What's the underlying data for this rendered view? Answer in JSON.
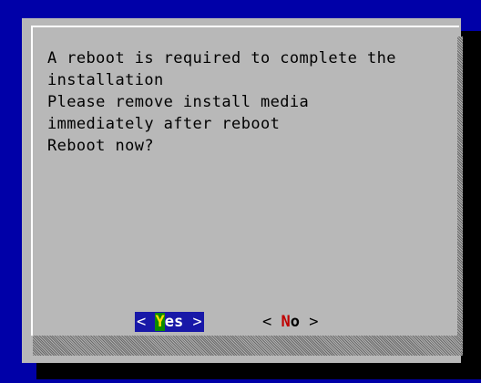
{
  "dialog": {
    "message_lines": [
      "A reboot is required to complete the",
      "installation",
      "Please remove install media",
      "immediately after reboot",
      "Reboot now?"
    ]
  },
  "buttons": {
    "yes": {
      "open": "< ",
      "hotkey": "Y",
      "rest": "es",
      "close": " >"
    },
    "no": {
      "open": "< ",
      "hotkey": "N",
      "rest": "o",
      "close": " >"
    }
  },
  "colors": {
    "desktop": "#0000a8",
    "dialog": "#b8b8b8",
    "selected_button": "#1818a8",
    "hotkey_selected": "#ffe000",
    "hotkey_unselected": "#c00000"
  }
}
